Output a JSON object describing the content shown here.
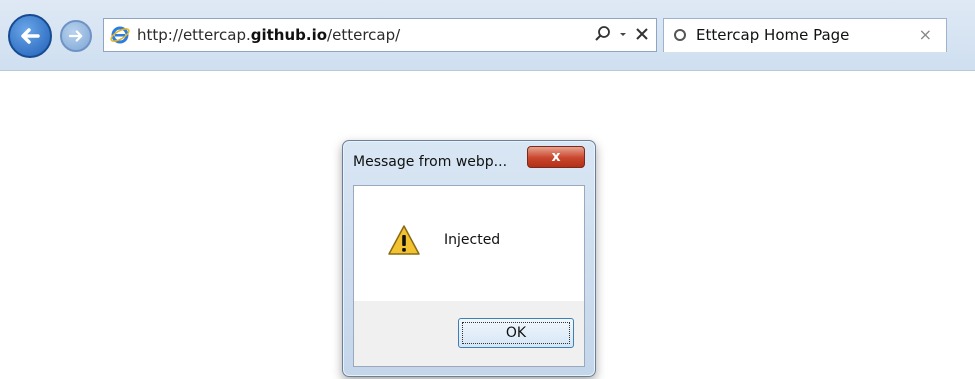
{
  "browser": {
    "url_prefix": "http://ettercap.",
    "url_domain": "github.io",
    "url_suffix": "/ettercap/",
    "tab_title": "Ettercap Home Page",
    "tab_close": "×",
    "search_icon": "search-icon",
    "refresh_icon": "close-icon"
  },
  "dialog": {
    "title": "Message from webp...",
    "close_label": "x",
    "message": "Injected",
    "ok_label": "OK",
    "icon": "warning-icon"
  },
  "colors": {
    "accent": "#1f5fb8",
    "close": "#c9452d"
  }
}
